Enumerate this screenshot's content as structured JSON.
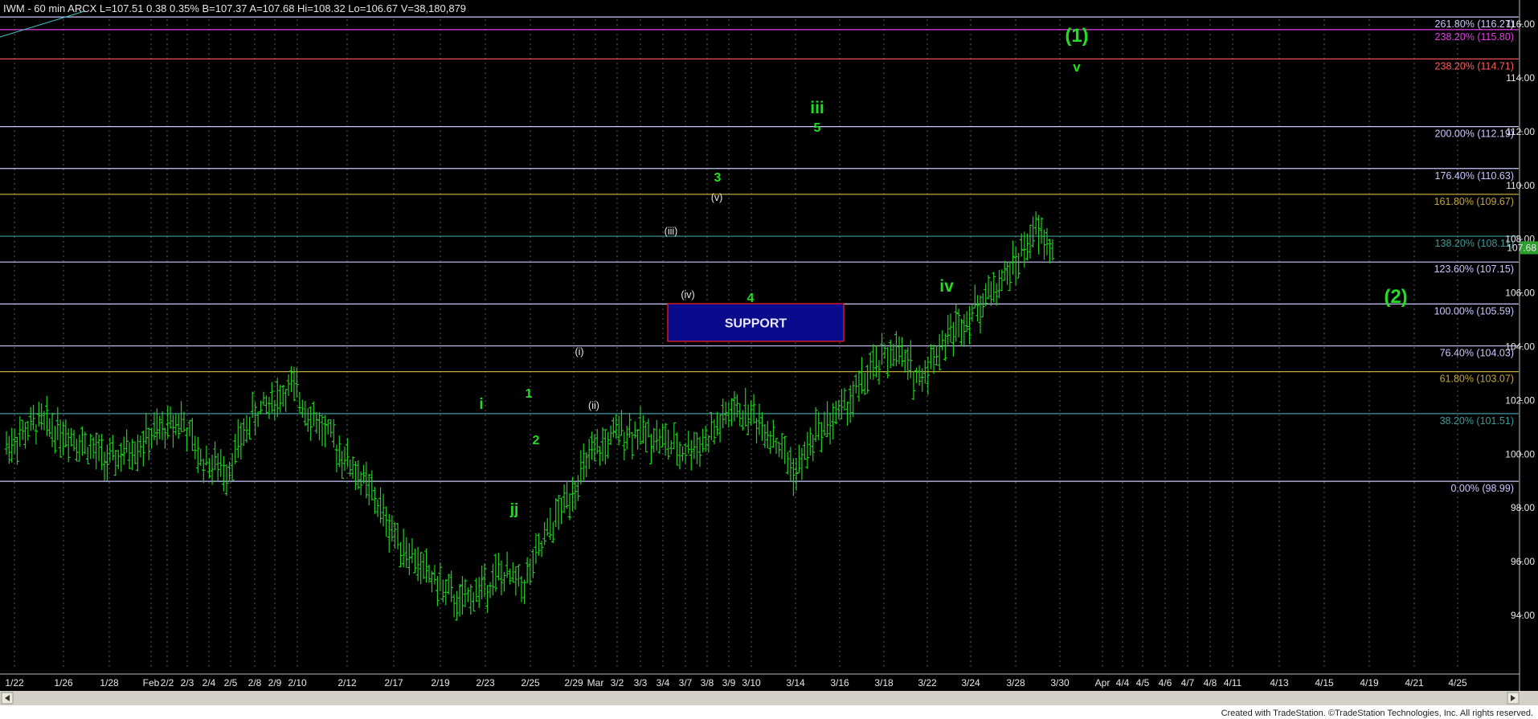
{
  "header": {
    "text": "IWM - 60 min  ARCX  L=107.51  0.38  0.35%  B=107.37  A=107.68  Hi=108.32  Lo=106.67  V=38,180,879"
  },
  "footer": {
    "credit": "Created with TradeStation. ©TradeStation Technologies, Inc. All rights reserved."
  },
  "colors": {
    "background": "#000000",
    "bar": "#22cc22",
    "wave_label": "#22dd22",
    "grid": "#5a5a5a",
    "support_fill": "#0a0a8c",
    "support_border": "#ff2020",
    "price_tag": "#2e9e2e"
  },
  "chart_data": {
    "type": "ohlc",
    "symbol": "IWM",
    "interval": "60 min",
    "y_range": [
      93,
      117.2
    ],
    "y_ticks": [
      94,
      96,
      98,
      100,
      102,
      104,
      106,
      108,
      110,
      112,
      114,
      116
    ],
    "y_tick_labels": [
      "94.00",
      "96.00",
      "98.00",
      "100.00",
      "102.00",
      "104.00",
      "106.00",
      "108.00",
      "110.00",
      "112.00",
      "114.00",
      "116.00"
    ],
    "last_price": {
      "value": 107.68,
      "label": "107.68"
    },
    "x_labels": [
      "1/22",
      "1/26",
      "1/28",
      "Feb",
      "2/2",
      "2/3",
      "2/4",
      "2/5",
      "2/8",
      "2/9",
      "2/10",
      "2/12",
      "2/17",
      "2/19",
      "2/23",
      "2/25",
      "2/29",
      "Mar",
      "3/2",
      "3/3",
      "3/4",
      "3/7",
      "3/8",
      "3/9",
      "3/10",
      "3/14",
      "3/16",
      "3/18",
      "3/22",
      "3/24",
      "3/28",
      "3/30",
      "Apr",
      "4/4",
      "4/5",
      "4/6",
      "4/7",
      "4/8",
      "4/11",
      "4/13",
      "4/15",
      "4/19",
      "4/21",
      "4/25"
    ],
    "price_path": [
      [
        0,
        100.3
      ],
      [
        5,
        101.2
      ],
      [
        10,
        100.7
      ],
      [
        16,
        99.7
      ],
      [
        22,
        100.6
      ],
      [
        27,
        101.3
      ],
      [
        30,
        99.8
      ],
      [
        34,
        99.4
      ],
      [
        38,
        101.4
      ],
      [
        44,
        102.5
      ],
      [
        47,
        101.5
      ],
      [
        51,
        100.3
      ],
      [
        56,
        98.7
      ],
      [
        60,
        97.0
      ],
      [
        64,
        95.8
      ],
      [
        70,
        94.4
      ],
      [
        76,
        95.5
      ],
      [
        80,
        95.2
      ],
      [
        84,
        97.2
      ],
      [
        90,
        99.8
      ],
      [
        95,
        100.9
      ],
      [
        100,
        100.7
      ],
      [
        104,
        100.1
      ],
      [
        108,
        100.5
      ],
      [
        112,
        101.6
      ],
      [
        115,
        101.5
      ],
      [
        118,
        100.8
      ],
      [
        122,
        99.3
      ],
      [
        125,
        100.8
      ],
      [
        129,
        101.6
      ],
      [
        133,
        102.9
      ],
      [
        137,
        103.9
      ],
      [
        141,
        102.8
      ],
      [
        145,
        104.3
      ],
      [
        150,
        105.5
      ],
      [
        155,
        106.8
      ],
      [
        159,
        108.3
      ],
      [
        162,
        107.5
      ]
    ],
    "fib_levels": [
      {
        "label": "261.80% (116.27)",
        "price": 116.27,
        "color": "#c8c8ff"
      },
      {
        "label": "238.20% (115.80)",
        "price": 115.8,
        "color": "#e040e0"
      },
      {
        "label": "238.20% (114.71)",
        "price": 114.71,
        "color": "#ff5b5b"
      },
      {
        "label": "200.00% (112.19)",
        "price": 112.19,
        "color": "#c8c8ff"
      },
      {
        "label": "176.40% (110.63)",
        "price": 110.63,
        "color": "#c8c8ff"
      },
      {
        "label": "161.80% (109.67)",
        "price": 109.67,
        "color": "#c2a63e"
      },
      {
        "label": "138.20% (108.11)",
        "price": 108.11,
        "color": "#3f9a9a"
      },
      {
        "label": "123.60% (107.15)",
        "price": 107.15,
        "color": "#c8c8ff"
      },
      {
        "label": "100.00% (105.59)",
        "price": 105.59,
        "color": "#c8c8ff"
      },
      {
        "label": "76.40% (104.03)",
        "price": 104.03,
        "color": "#c8c8ff"
      },
      {
        "label": "61.80% (103.07)",
        "price": 103.07,
        "color": "#c2a63e"
      },
      {
        "label": "38.20% (101.51)",
        "price": 101.51,
        "color": "#3f9a9a"
      },
      {
        "label": "0.00% (98.99)",
        "price": 98.99,
        "color": "#c8c8ff"
      }
    ],
    "support_zone": {
      "label": "SUPPORT",
      "price_top": 105.6,
      "price_bottom": 104.2,
      "date_start": "3/7",
      "date_end": "3/14"
    },
    "wave_labels": [
      {
        "text": "(1)",
        "style": "big"
      },
      {
        "text": "v",
        "style": "mid"
      },
      {
        "text": "iii",
        "style": "mid"
      },
      {
        "text": "5",
        "style": "small"
      },
      {
        "text": "3",
        "style": "small"
      },
      {
        "text": "(v)",
        "style": "sub"
      },
      {
        "text": "(iii)",
        "style": "sub"
      },
      {
        "text": "(iv)",
        "style": "sub"
      },
      {
        "text": "4",
        "style": "small"
      },
      {
        "text": "iv",
        "style": "mid"
      },
      {
        "text": "(2)",
        "style": "big"
      },
      {
        "text": "(i)",
        "style": "sub"
      },
      {
        "text": "(ii)",
        "style": "sub"
      },
      {
        "text": "i",
        "style": "mid"
      },
      {
        "text": "1",
        "style": "small"
      },
      {
        "text": "2",
        "style": "small"
      },
      {
        "text": "jj",
        "style": "mid"
      }
    ]
  }
}
